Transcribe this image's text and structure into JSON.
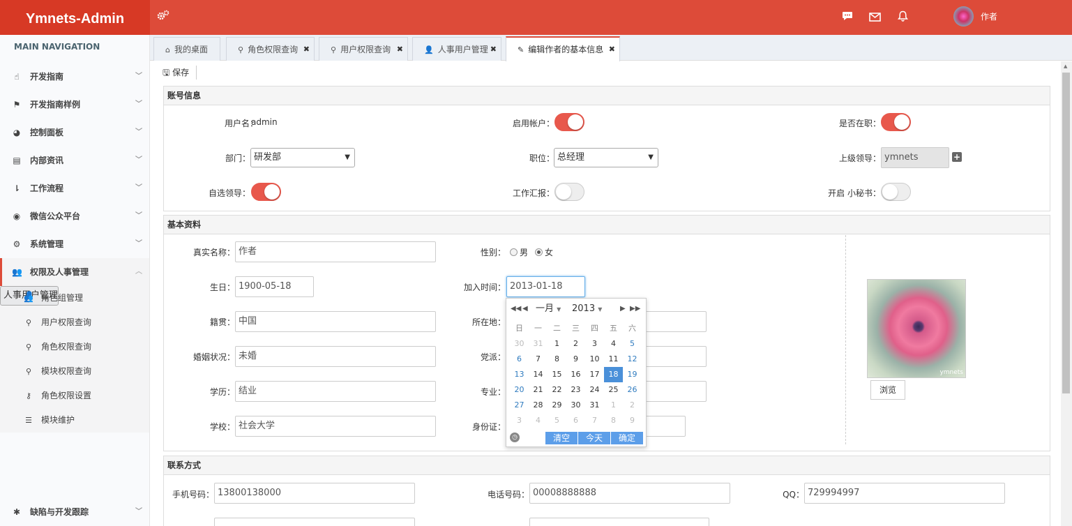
{
  "app": {
    "logo": "Ymnets-Admin",
    "user_name": "作者"
  },
  "topbar_icons": [
    "cogs-icon",
    "comment-icon",
    "envelope-icon",
    "bell-icon"
  ],
  "sidebar": {
    "header": "MAIN NAVIGATION",
    "items": [
      {
        "label": "开发指南",
        "icon": "hand-icon"
      },
      {
        "label": "开发指南样例",
        "icon": "flag-icon"
      },
      {
        "label": "控制面板",
        "icon": "dashboard-icon"
      },
      {
        "label": "内部资讯",
        "icon": "newspaper-icon"
      },
      {
        "label": "工作流程",
        "icon": "sort-icon"
      },
      {
        "label": "微信公众平台",
        "icon": "wechat-icon"
      },
      {
        "label": "系统管理",
        "icon": "cogs-icon"
      },
      {
        "label": "权限及人事管理",
        "icon": "users-icon"
      }
    ],
    "subitems": [
      {
        "label": "人事用户管理",
        "icon": "user-icon"
      },
      {
        "label": "角色组管理",
        "icon": "users-icon"
      },
      {
        "label": "用户权限查询",
        "icon": "search-icon"
      },
      {
        "label": "角色权限查询",
        "icon": "search-icon"
      },
      {
        "label": "模块权限查询",
        "icon": "search-icon"
      },
      {
        "label": "角色权限设置",
        "icon": "key-icon"
      },
      {
        "label": "模块维护",
        "icon": "list-icon"
      }
    ],
    "bottom_item": "缺陷与开发跟踪"
  },
  "tabs": [
    {
      "label": "我的桌面",
      "icon": "home-icon"
    },
    {
      "label": "角色权限查询",
      "icon": "search-icon"
    },
    {
      "label": "用户权限查询",
      "icon": "search-icon"
    },
    {
      "label": "人事用户管理",
      "icon": "user-icon"
    },
    {
      "label": "编辑作者的基本信息",
      "icon": "pencil-icon"
    }
  ],
  "toolbar": {
    "save_label": "保存"
  },
  "account": {
    "title": "账号信息",
    "username_label": "用户名：",
    "username": "admin",
    "enabled_label": "启用帐户：",
    "enabled": true,
    "employed_label": "是否在职：",
    "employed": true,
    "dept_label": "部门：",
    "dept": "研发部",
    "position_label": "职位：",
    "position": "总经理",
    "leader_label": "上级领导：",
    "leader": "ymnets",
    "self_leader_label": "自选领导：",
    "self_leader": true,
    "report_label": "工作汇报：",
    "report": false,
    "secretary_label": "开启 小秘书：",
    "secretary": false
  },
  "basic": {
    "title": "基本资料",
    "realname_label": "真实名称：",
    "realname": "作者",
    "gender_label": "性别：",
    "gender_male": "男",
    "gender_female": "女",
    "birthday_label": "生日：",
    "birthday": "1900-05-18",
    "join_label": "加入时间：",
    "join": "2013-01-18",
    "native_label": "籍贯：",
    "native": "中国",
    "location_label": "所在地：",
    "marital_label": "婚姻状况：",
    "marital": "未婚",
    "party_label": "党派：",
    "education_label": "学历：",
    "education": "结业",
    "major_label": "专业：",
    "school_label": "学校：",
    "school": "社会大学",
    "idcard_label": "身份证：",
    "photo_watermark": "ymnets",
    "browse_label": "浏览"
  },
  "calendar": {
    "month": "一月",
    "year": "2013",
    "weekdays": [
      "日",
      "一",
      "二",
      "三",
      "四",
      "五",
      "六"
    ],
    "weeks": [
      [
        "30",
        "31",
        "1",
        "2",
        "3",
        "4",
        "5"
      ],
      [
        "6",
        "7",
        "8",
        "9",
        "10",
        "11",
        "12"
      ],
      [
        "13",
        "14",
        "15",
        "16",
        "17",
        "18",
        "19"
      ],
      [
        "20",
        "21",
        "22",
        "23",
        "24",
        "25",
        "26"
      ],
      [
        "27",
        "28",
        "29",
        "30",
        "31",
        "1",
        "2"
      ],
      [
        "3",
        "4",
        "5",
        "6",
        "7",
        "8",
        "9"
      ]
    ],
    "selected": "18",
    "clear_label": "清空",
    "today_label": "今天",
    "ok_label": "确定"
  },
  "contact": {
    "title": "联系方式",
    "mobile_label": "手机号码：",
    "mobile": "13800138000",
    "phone_label": "电话号码：",
    "phone": "00008888888",
    "qq_label": "QQ：",
    "qq": "729994997"
  }
}
